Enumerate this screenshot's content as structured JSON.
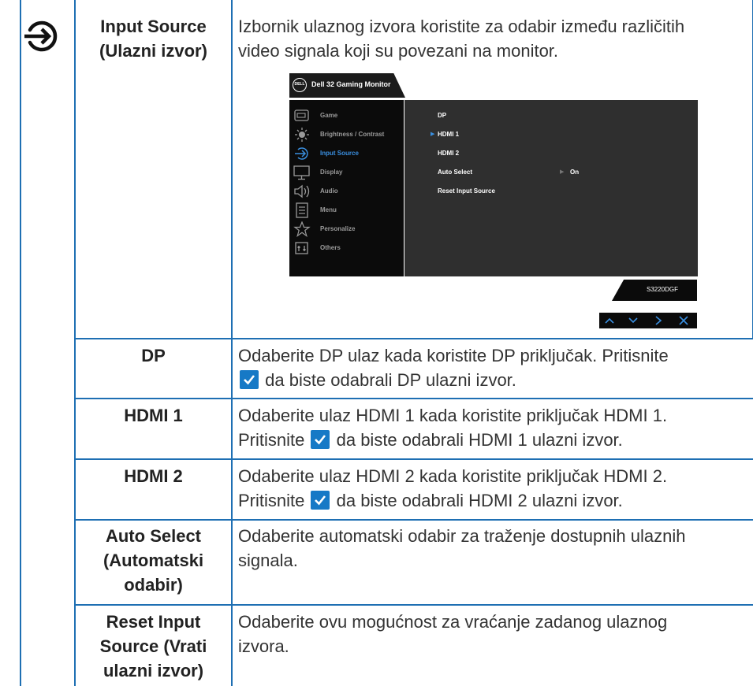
{
  "rows": [
    {
      "label": "Input Source (Ulazni izvor)",
      "label_lines": [
        "Input Source",
        "(Ulazni izvor)"
      ],
      "desc_lines": [
        "Izbornik ulaznog izvora koristite za odabir između različitih",
        "video signala koji su povezani na monitor."
      ]
    },
    {
      "label": "DP",
      "desc_line1": "Odaberite DP ulaz kada koristite DP priključak. Pritisnite",
      "desc_line2": "da biste odabrali DP ulazni izvor."
    },
    {
      "label": "HDMI 1",
      "desc_line1": "Odaberite ulaz HDMI 1 kada koristite priključak HDMI 1.",
      "desc_line2_pre": "Pritisnite",
      "desc_line2_post": "da biste odabrali HDMI 1 ulazni izvor."
    },
    {
      "label": "HDMI 2",
      "desc_line1": "Odaberite ulaz HDMI 2 kada koristite priključak HDMI 2.",
      "desc_line2_pre": "Pritisnite",
      "desc_line2_post": "da biste odabrali HDMI 2 ulazni izvor."
    },
    {
      "label_lines": [
        "Auto Select",
        "(Automatski",
        "odabir)"
      ],
      "desc_lines": [
        "Odaberite automatski odabir za traženje dostupnih ulaznih",
        "signala."
      ]
    },
    {
      "label_lines": [
        "Reset Input",
        "Source (Vrati",
        "ulazni izvor)"
      ],
      "desc_lines": [
        "Odaberite ovu mogućnost za vraćanje zadanog ulaznog",
        "izvora."
      ]
    }
  ],
  "osd": {
    "logo_text": "DELL",
    "title": "Dell 32 Gaming Monitor",
    "menu": [
      {
        "label": "Game",
        "icon": "game-icon"
      },
      {
        "label": "Brightness / Contrast",
        "icon": "brightness-icon"
      },
      {
        "label": "Input Source",
        "icon": "input-source-icon",
        "active": true
      },
      {
        "label": "Display",
        "icon": "display-icon"
      },
      {
        "label": "Audio",
        "icon": "audio-icon"
      },
      {
        "label": "Menu",
        "icon": "menu-icon"
      },
      {
        "label": "Personalize",
        "icon": "star-icon"
      },
      {
        "label": "Others",
        "icon": "others-icon"
      }
    ],
    "options": [
      {
        "label": "DP"
      },
      {
        "label": "HDMI 1",
        "selected": true
      },
      {
        "label": "HDMI 2"
      },
      {
        "label": "Auto Select",
        "value": "On"
      },
      {
        "label": "Reset Input Source"
      }
    ],
    "model": "S3220DGF",
    "nav_buttons": [
      "up-icon",
      "down-icon",
      "right-icon",
      "close-icon"
    ]
  },
  "colors": {
    "border": "#1e6fb3",
    "accent": "#3a8fe0",
    "check": "#1679c6"
  }
}
